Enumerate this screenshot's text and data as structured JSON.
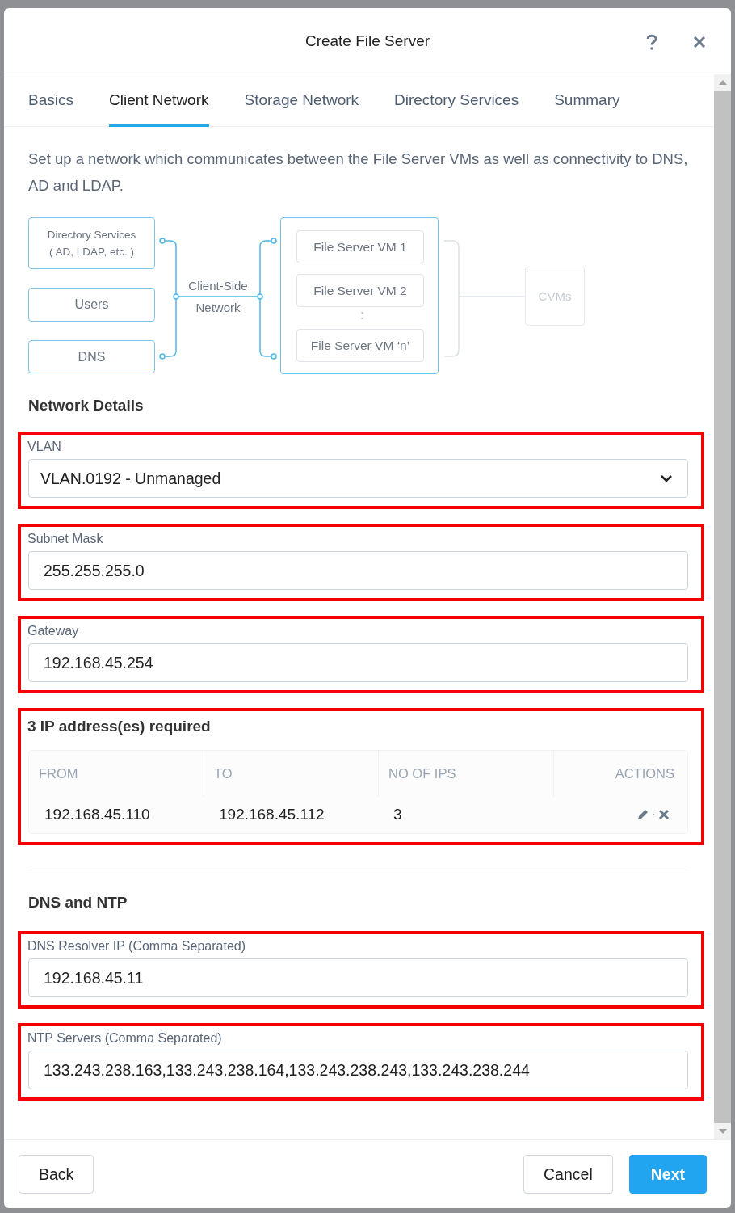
{
  "dialog": {
    "title": "Create File Server"
  },
  "tabs": [
    {
      "label": "Basics",
      "selected": false
    },
    {
      "label": "Client Network",
      "selected": true
    },
    {
      "label": "Storage Network",
      "selected": false
    },
    {
      "label": "Directory Services",
      "selected": false
    },
    {
      "label": "Summary",
      "selected": false
    }
  ],
  "description": "Set up a network which communicates between the File Server VMs as well as connectivity to DNS, AD and LDAP.",
  "diagram": {
    "clients": [
      {
        "lines": [
          "Directory Services",
          "( AD, LDAP, etc. )"
        ]
      },
      {
        "lines": [
          "Users"
        ]
      },
      {
        "lines": [
          "DNS"
        ]
      }
    ],
    "network_label": "Client-Side Network",
    "vms": [
      "File Server VM 1",
      "File Server VM 2",
      "File Server VM ‘n’"
    ],
    "ellipsis": ":",
    "cvms": "CVMs"
  },
  "network_details": {
    "heading": "Network Details",
    "fields": [
      {
        "kind": "select",
        "label": "VLAN",
        "value": "VLAN.0192 - Unmanaged",
        "highlighted": true
      },
      {
        "kind": "text",
        "label": "Subnet Mask",
        "value": "255.255.255.0",
        "highlighted": true
      },
      {
        "kind": "text",
        "label": "Gateway",
        "value": "192.168.45.254",
        "highlighted": true
      }
    ]
  },
  "ip_ranges": {
    "title": "3 IP address(es) required",
    "highlighted": true,
    "columns": [
      "FROM",
      "TO",
      "NO OF IPS",
      "ACTIONS"
    ],
    "rows": [
      {
        "from": "192.168.45.110",
        "to": "192.168.45.112",
        "count": "3"
      }
    ]
  },
  "dns_ntp": {
    "heading": "DNS and NTP",
    "fields": [
      {
        "kind": "text",
        "label": "DNS Resolver IP (Comma Separated)",
        "value": "192.168.45.11",
        "highlighted": true
      },
      {
        "kind": "text",
        "label": "NTP Servers (Comma Separated)",
        "value": "133.243.238.163,133.243.238.164,133.243.238.243,133.243.238.244",
        "highlighted": true
      }
    ]
  },
  "footer": {
    "back": "Back",
    "cancel": "Cancel",
    "next": "Next"
  }
}
